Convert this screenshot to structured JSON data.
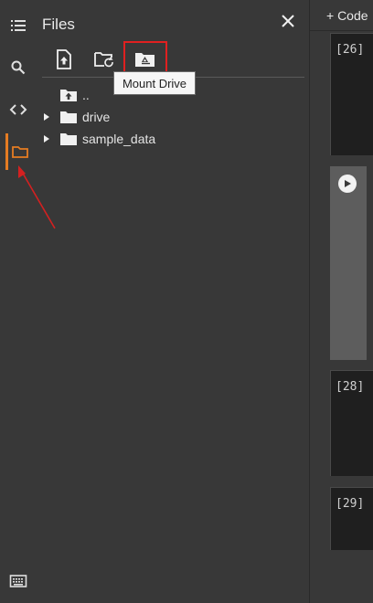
{
  "rail": {
    "items": [
      {
        "name": "toc",
        "icon": "list-icon"
      },
      {
        "name": "search",
        "icon": "search-icon"
      },
      {
        "name": "snippets",
        "icon": "code-icon"
      },
      {
        "name": "files",
        "icon": "folder-icon",
        "active": true
      }
    ],
    "bottom_icon": "terminal-icon",
    "active_color": "#e67c22"
  },
  "panel": {
    "title": "Files",
    "toolbar": {
      "upload_icon": "upload-file-icon",
      "refresh_icon": "refresh-folder-icon",
      "mount_icon": "mount-drive-icon"
    },
    "tooltip": "Mount Drive",
    "tree": [
      {
        "label": "..",
        "type": "parent",
        "icon": "folder-up-icon"
      },
      {
        "label": "drive",
        "type": "folder",
        "expandable": true
      },
      {
        "label": "sample_data",
        "type": "folder",
        "expandable": true
      }
    ]
  },
  "notebook": {
    "add_code_label": "+ Code",
    "cells": [
      {
        "label": "[26]"
      },
      {
        "label": ""
      },
      {
        "label": "[28]"
      },
      {
        "label": "[29]"
      }
    ]
  },
  "annotation": {
    "highlight_color": "#e02020",
    "arrow_color": "#d42020"
  }
}
